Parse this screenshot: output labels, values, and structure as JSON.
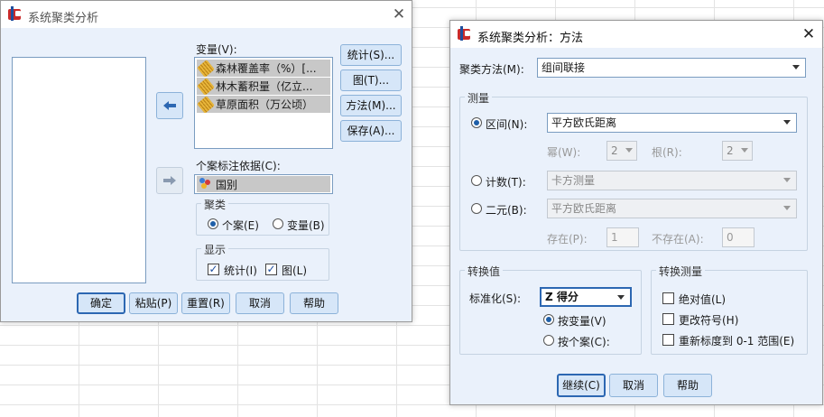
{
  "main_dialog": {
    "title": "系统聚类分析",
    "variables_label": "变量(V):",
    "variables": [
      "森林覆盖率（%）[...",
      "林木蓄积量（亿立...",
      "草原面积（万公顷）"
    ],
    "case_label_by": "个案标注依据(C):",
    "case_label_var": "国别",
    "cluster_group": {
      "title": "聚类",
      "options": [
        "个案(E)",
        "变量(B)"
      ],
      "selected": "个案(E)"
    },
    "display_group": {
      "title": "显示",
      "checks": [
        {
          "label": "统计(I)",
          "checked": true
        },
        {
          "label": "图(L)",
          "checked": true
        }
      ]
    },
    "side_buttons": [
      "统计(S)...",
      "图(T)...",
      "方法(M)...",
      "保存(A)..."
    ],
    "bottom_buttons": [
      "确定",
      "粘贴(P)",
      "重置(R)",
      "取消",
      "帮助"
    ]
  },
  "method_dialog": {
    "title": "系统聚类分析：方法",
    "cluster_method_label": "聚类方法(M):",
    "cluster_method_value": "组间联接",
    "measure_group": {
      "title": "测量",
      "interval": {
        "label": "区间(N):",
        "value": "平方欧氏距离",
        "selected": true
      },
      "power_label": "幂(W):",
      "power_value": "2",
      "root_label": "根(R):",
      "root_value": "2",
      "counts": {
        "label": "计数(T):",
        "value": "卡方测量"
      },
      "binary": {
        "label": "二元(B):",
        "value": "平方欧氏距离"
      },
      "present_label": "存在(P):",
      "present_value": "1",
      "absent_label": "不存在(A):",
      "absent_value": "0"
    },
    "transform_values": {
      "title": "转换值",
      "standardize_label": "标准化(S):",
      "standardize_value": "Z 得分",
      "options": [
        "按变量(V)",
        "按个案(C):"
      ],
      "selected": "按变量(V)"
    },
    "transform_measures": {
      "title": "转换测量",
      "checks": [
        {
          "label": "绝对值(L)",
          "checked": false
        },
        {
          "label": "更改符号(H)",
          "checked": false
        },
        {
          "label": "重新标度到 0-1 范围(E)",
          "checked": false
        }
      ]
    },
    "buttons": [
      "继续(C)",
      "取消",
      "帮助"
    ]
  },
  "colors": {
    "dialog_bg": "#eaf1fb",
    "button_bg": "#d6e6f8",
    "accent": "#2c67b2"
  }
}
